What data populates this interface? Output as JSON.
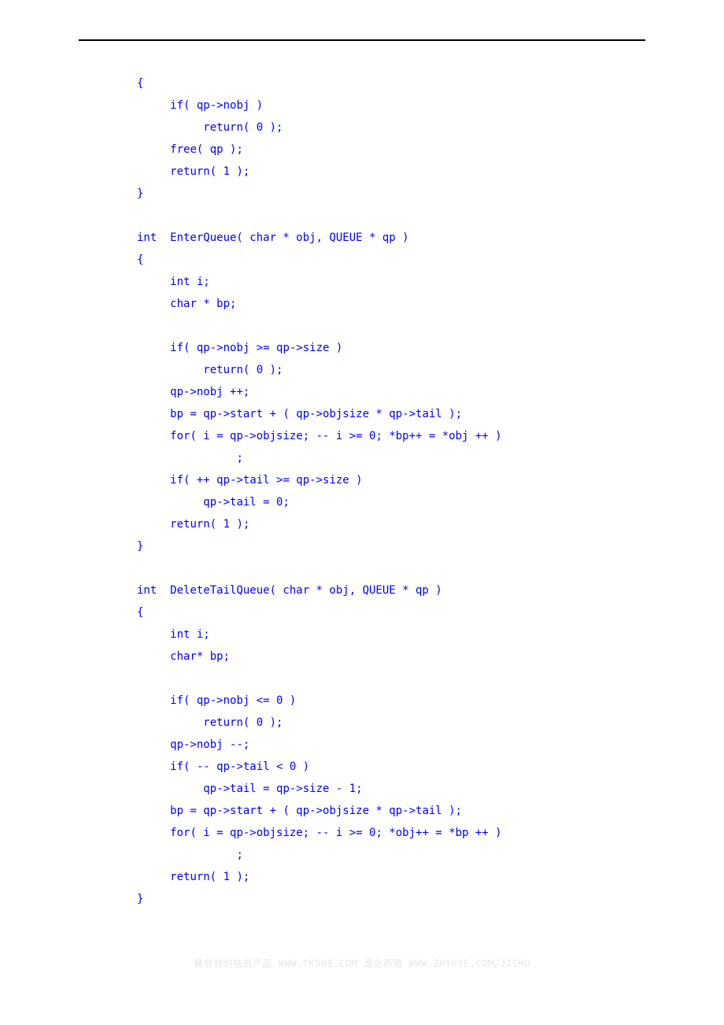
{
  "code": {
    "lines": [
      {
        "indent": 0,
        "text": "{"
      },
      {
        "indent": 1,
        "text": "if( qp->nobj )"
      },
      {
        "indent": 2,
        "text": "return( 0 );"
      },
      {
        "indent": 1,
        "text": "free( qp );"
      },
      {
        "indent": 1,
        "text": "return( 1 );"
      },
      {
        "indent": 0,
        "text": "}"
      },
      {
        "indent": 0,
        "text": ""
      },
      {
        "indent": 0,
        "text": "int  EnterQueue( char * obj, QUEUE * qp )"
      },
      {
        "indent": 0,
        "text": "{"
      },
      {
        "indent": 1,
        "text": "int i;"
      },
      {
        "indent": 1,
        "text": "char * bp;"
      },
      {
        "indent": 0,
        "text": ""
      },
      {
        "indent": 1,
        "text": "if( qp->nobj >= qp->size )"
      },
      {
        "indent": 2,
        "text": "return( 0 );"
      },
      {
        "indent": 1,
        "text": "qp->nobj ++;"
      },
      {
        "indent": 1,
        "text": "bp = qp->start + ( qp->objsize * qp->tail );"
      },
      {
        "indent": 1,
        "text": "for( i = qp->objsize; -- i >= 0; *bp++ = *obj ++ )"
      },
      {
        "indent": 3,
        "text": ";"
      },
      {
        "indent": 1,
        "text": "if( ++ qp->tail >= qp->size )"
      },
      {
        "indent": 2,
        "text": "qp->tail = 0;"
      },
      {
        "indent": 1,
        "text": "return( 1 );"
      },
      {
        "indent": 0,
        "text": "}"
      },
      {
        "indent": 0,
        "text": ""
      },
      {
        "indent": 0,
        "text": "int  DeleteTailQueue( char * obj, QUEUE * qp )"
      },
      {
        "indent": 0,
        "text": "{"
      },
      {
        "indent": 1,
        "text": "int i;"
      },
      {
        "indent": 1,
        "text": "char* bp;"
      },
      {
        "indent": 0,
        "text": ""
      },
      {
        "indent": 1,
        "text": "if( qp->nobj <= 0 )"
      },
      {
        "indent": 2,
        "text": "return( 0 );"
      },
      {
        "indent": 1,
        "text": "qp->nobj --;"
      },
      {
        "indent": 1,
        "text": "if( -- qp->tail < 0 )"
      },
      {
        "indent": 2,
        "text": "qp->tail = qp->size - 1;"
      },
      {
        "indent": 1,
        "text": "bp = qp->start + ( qp->objsize * qp->tail );"
      },
      {
        "indent": 1,
        "text": "for( i = qp->objsize; -- i >= 0; *obj++ = *bp ++ )"
      },
      {
        "indent": 3,
        "text": ";"
      },
      {
        "indent": 1,
        "text": "return( 1 );"
      },
      {
        "indent": 0,
        "text": "}"
      }
    ]
  },
  "watermark": "最有效的祛斑产品 WWW.TK508.COM 渔业养殖 WWW.ZHYUYE.COM/JISHU"
}
